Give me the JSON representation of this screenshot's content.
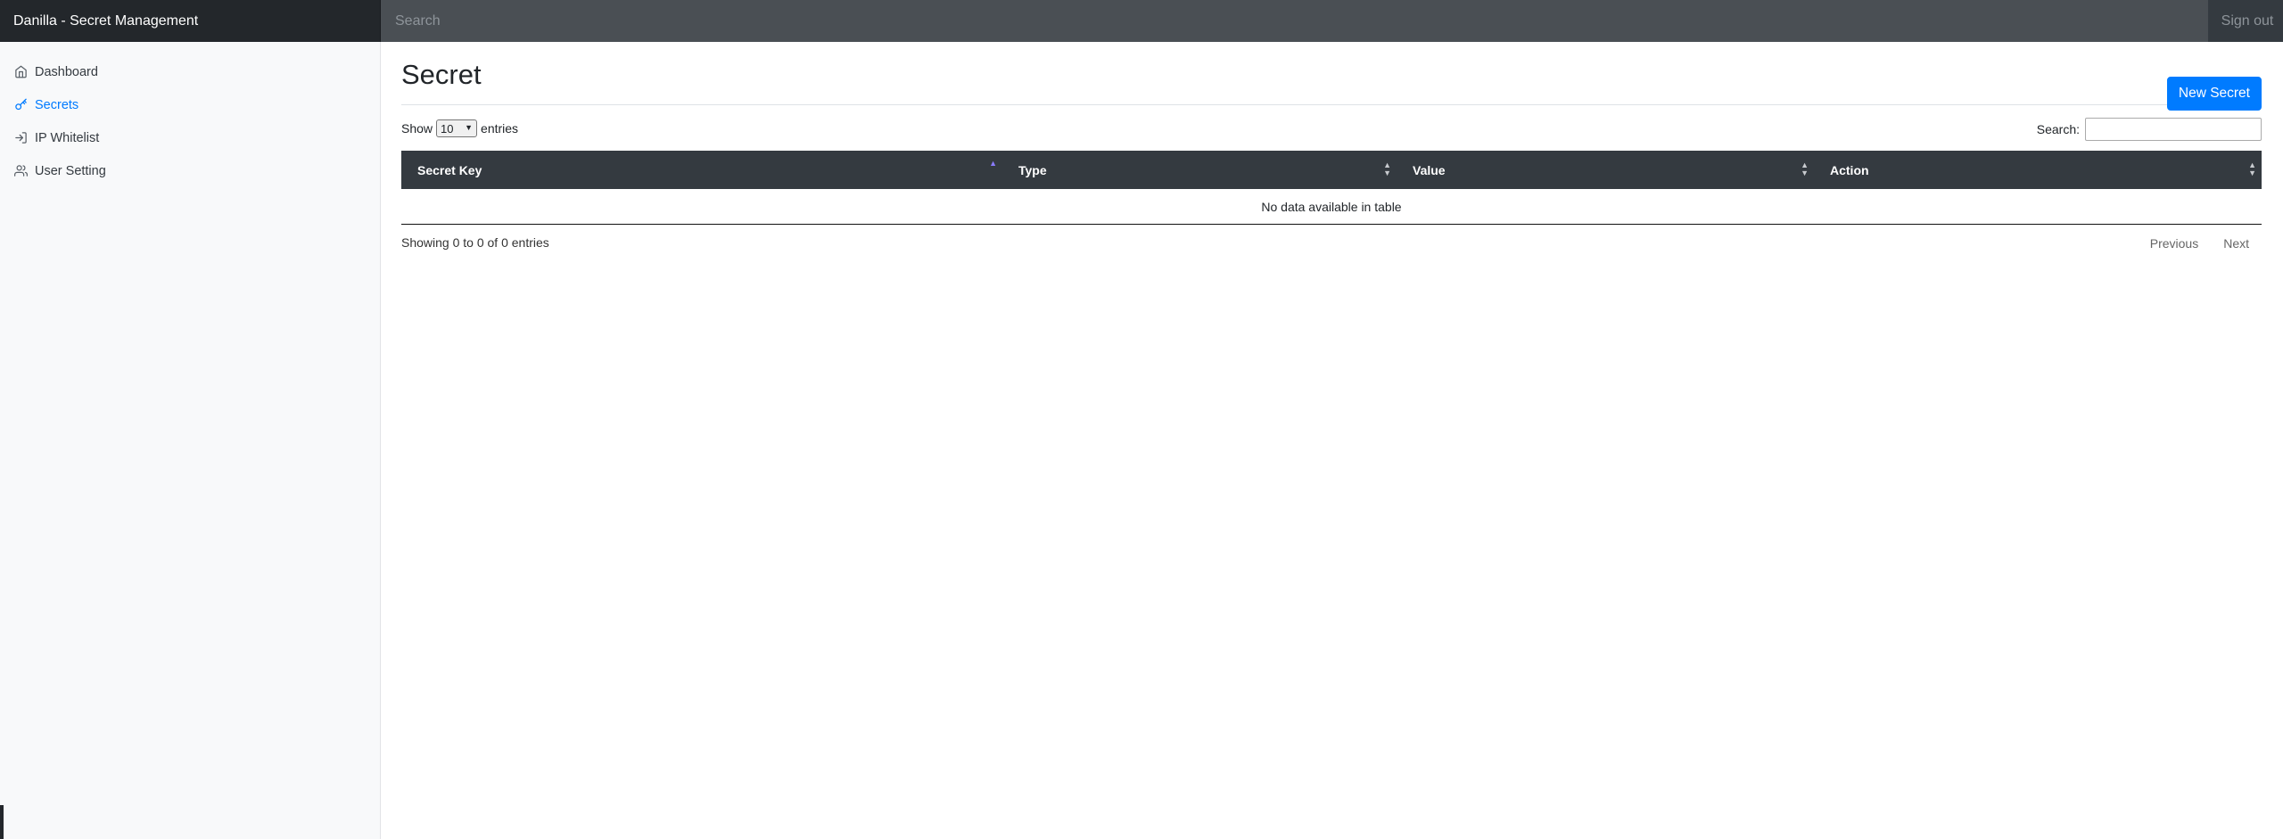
{
  "app": {
    "title": "Danilla - Secret Management"
  },
  "topbar": {
    "search_placeholder": "Search",
    "signout_label": "Sign out"
  },
  "sidebar": {
    "items": [
      {
        "label": "Dashboard",
        "icon": "home-icon",
        "active": false
      },
      {
        "label": "Secrets",
        "icon": "key-icon",
        "active": true
      },
      {
        "label": "IP Whitelist",
        "icon": "log-in-icon",
        "active": false
      },
      {
        "label": "User Setting",
        "icon": "users-icon",
        "active": false
      }
    ]
  },
  "page": {
    "title": "Secret",
    "new_button_label": "New Secret"
  },
  "table_controls": {
    "show_label": "Show",
    "entries_value": "10",
    "entries_label": "entries",
    "search_label": "Search:"
  },
  "table": {
    "columns": [
      "Secret Key",
      "Type",
      "Value",
      "Action"
    ],
    "empty_message": "No data available in table"
  },
  "footer": {
    "info": "Showing 0 to 0 of 0 entries",
    "previous_label": "Previous",
    "next_label": "Next"
  },
  "colors": {
    "accent": "#007bff",
    "navbar": "#343a40",
    "brand_bg": "#23272b"
  }
}
